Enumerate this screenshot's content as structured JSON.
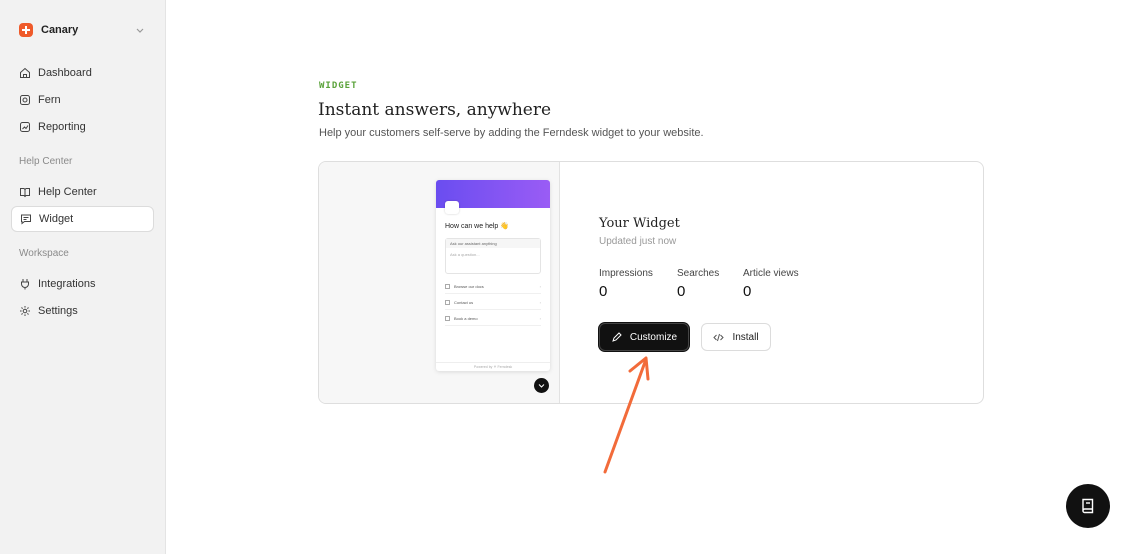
{
  "sidebar": {
    "workspace_name": "Canary",
    "top_items": [
      {
        "label": "Dashboard",
        "icon": "home-icon"
      },
      {
        "label": "Fern",
        "icon": "fern-icon"
      },
      {
        "label": "Reporting",
        "icon": "chart-icon"
      }
    ],
    "help_center_label": "Help Center",
    "help_items": [
      {
        "label": "Help Center",
        "icon": "book-icon"
      },
      {
        "label": "Widget",
        "icon": "chat-icon",
        "active": true
      }
    ],
    "workspace_label": "Workspace",
    "workspace_items": [
      {
        "label": "Integrations",
        "icon": "plug-icon"
      },
      {
        "label": "Settings",
        "icon": "gear-icon"
      }
    ]
  },
  "page": {
    "eyebrow": "WIDGET",
    "title": "Instant answers, anywhere",
    "subtitle": "Help your customers self-serve by adding the Ferndesk widget to your website."
  },
  "preview": {
    "question": "How can we help 👋",
    "ask_label": "Ask our assistant anything",
    "ask_placeholder": "Ask a question...",
    "links": [
      "Browse our docs",
      "Contact us",
      "Book a demo"
    ],
    "footer": "Powered by ⚘ Ferndesk"
  },
  "widget": {
    "title": "Your Widget",
    "updated": "Updated just now",
    "stats": [
      {
        "label": "Impressions",
        "value": "0"
      },
      {
        "label": "Searches",
        "value": "0"
      },
      {
        "label": "Article views",
        "value": "0"
      }
    ],
    "customize_label": "Customize",
    "install_label": "Install"
  },
  "colors": {
    "accent_green": "#5aa23a",
    "brand_orange": "#ef5a2a",
    "annotation_arrow": "#f26b3a",
    "widget_header": "#7a55f2"
  }
}
